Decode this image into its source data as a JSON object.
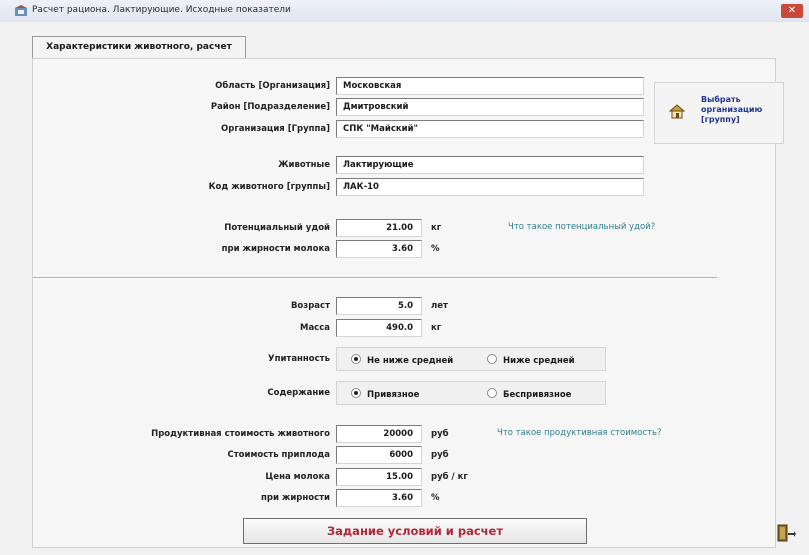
{
  "window": {
    "title": "Расчет рациона. Лактирующие. Исходные показатели",
    "close_label": "✕"
  },
  "tab": {
    "label": "Характеристики животного, расчет"
  },
  "org": {
    "region_label": "Область [Организация]",
    "region_value": "Московская",
    "district_label": "Район [Подразделение]",
    "district_value": "Дмитровский",
    "company_label": "Организация [Группа]",
    "company_value": "СПК \"Майский\"",
    "animals_label": "Животные",
    "animals_value": "Лактирующие",
    "code_label": "Код животного [группы]",
    "code_value": "ЛАК-10",
    "choose_button": "Выбрать организацию [группу]"
  },
  "yield": {
    "potential_label": "Потенциальный удой",
    "potential_value": "21.00",
    "potential_unit": "кг",
    "fat_label": "при жирности молока",
    "fat_value": "3.60",
    "fat_unit": "%",
    "help_link": "Что такое потенциальный удой?"
  },
  "animal": {
    "age_label": "Возраст",
    "age_value": "5.0",
    "age_unit": "лет",
    "mass_label": "Масса",
    "mass_value": "490.0",
    "mass_unit": "кг",
    "fatness_label": "Упитанность",
    "fatness_option_1": "Не ниже средней",
    "fatness_option_2": "Ниже средней",
    "keeping_label": "Содержание",
    "keeping_option_1": "Привязное",
    "keeping_option_2": "Беспривязное"
  },
  "economics": {
    "prod_value_label": "Продуктивная стоимость животного",
    "prod_value_value": "20000",
    "prod_value_unit": "руб",
    "offspring_label": "Стоимость приплода",
    "offspring_value": "6000",
    "offspring_unit": "руб",
    "milk_price_label": "Цена молока",
    "milk_price_value": "15.00",
    "milk_price_unit": "руб / кг",
    "fat_label": "при жирности",
    "fat_value": "3.60",
    "fat_unit": "%",
    "help_link": "Что такое продуктивная стоимость?"
  },
  "actions": {
    "calculate": "Задание условий и расчет"
  },
  "colors": {
    "link": "#2f7e8f",
    "button_text": "#b0283b",
    "choose_text": "#21378f"
  }
}
